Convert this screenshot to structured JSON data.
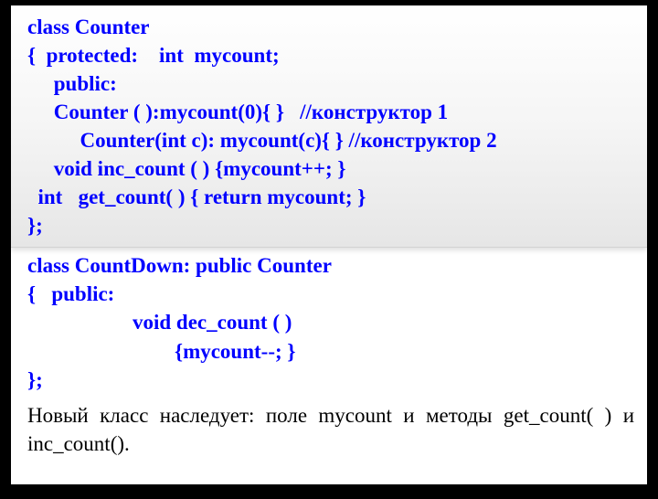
{
  "block1": {
    "l1": "class Counter",
    "l2": "{  protected:    int  mycount;",
    "l3": "     public:",
    "l4": "     Counter ( ):mycount(0){ }   //конструктор 1",
    "l5": "          Counter(int c): mycount(c){ } //конструктор 2",
    "l6": "     void inc_count ( ) {mycount++; }",
    "l7": "  int   get_count( ) { return mycount; }",
    "l8": "};"
  },
  "block2": {
    "l1": "class CountDown: public Counter",
    "l2": "{   public:",
    "l3": "                    void dec_count ( )",
    "l4": "                            {mycount--; }",
    "l5": "};"
  },
  "para": "Новый класс наследует: поле mycount и методы get_count( ) и inc_count()."
}
